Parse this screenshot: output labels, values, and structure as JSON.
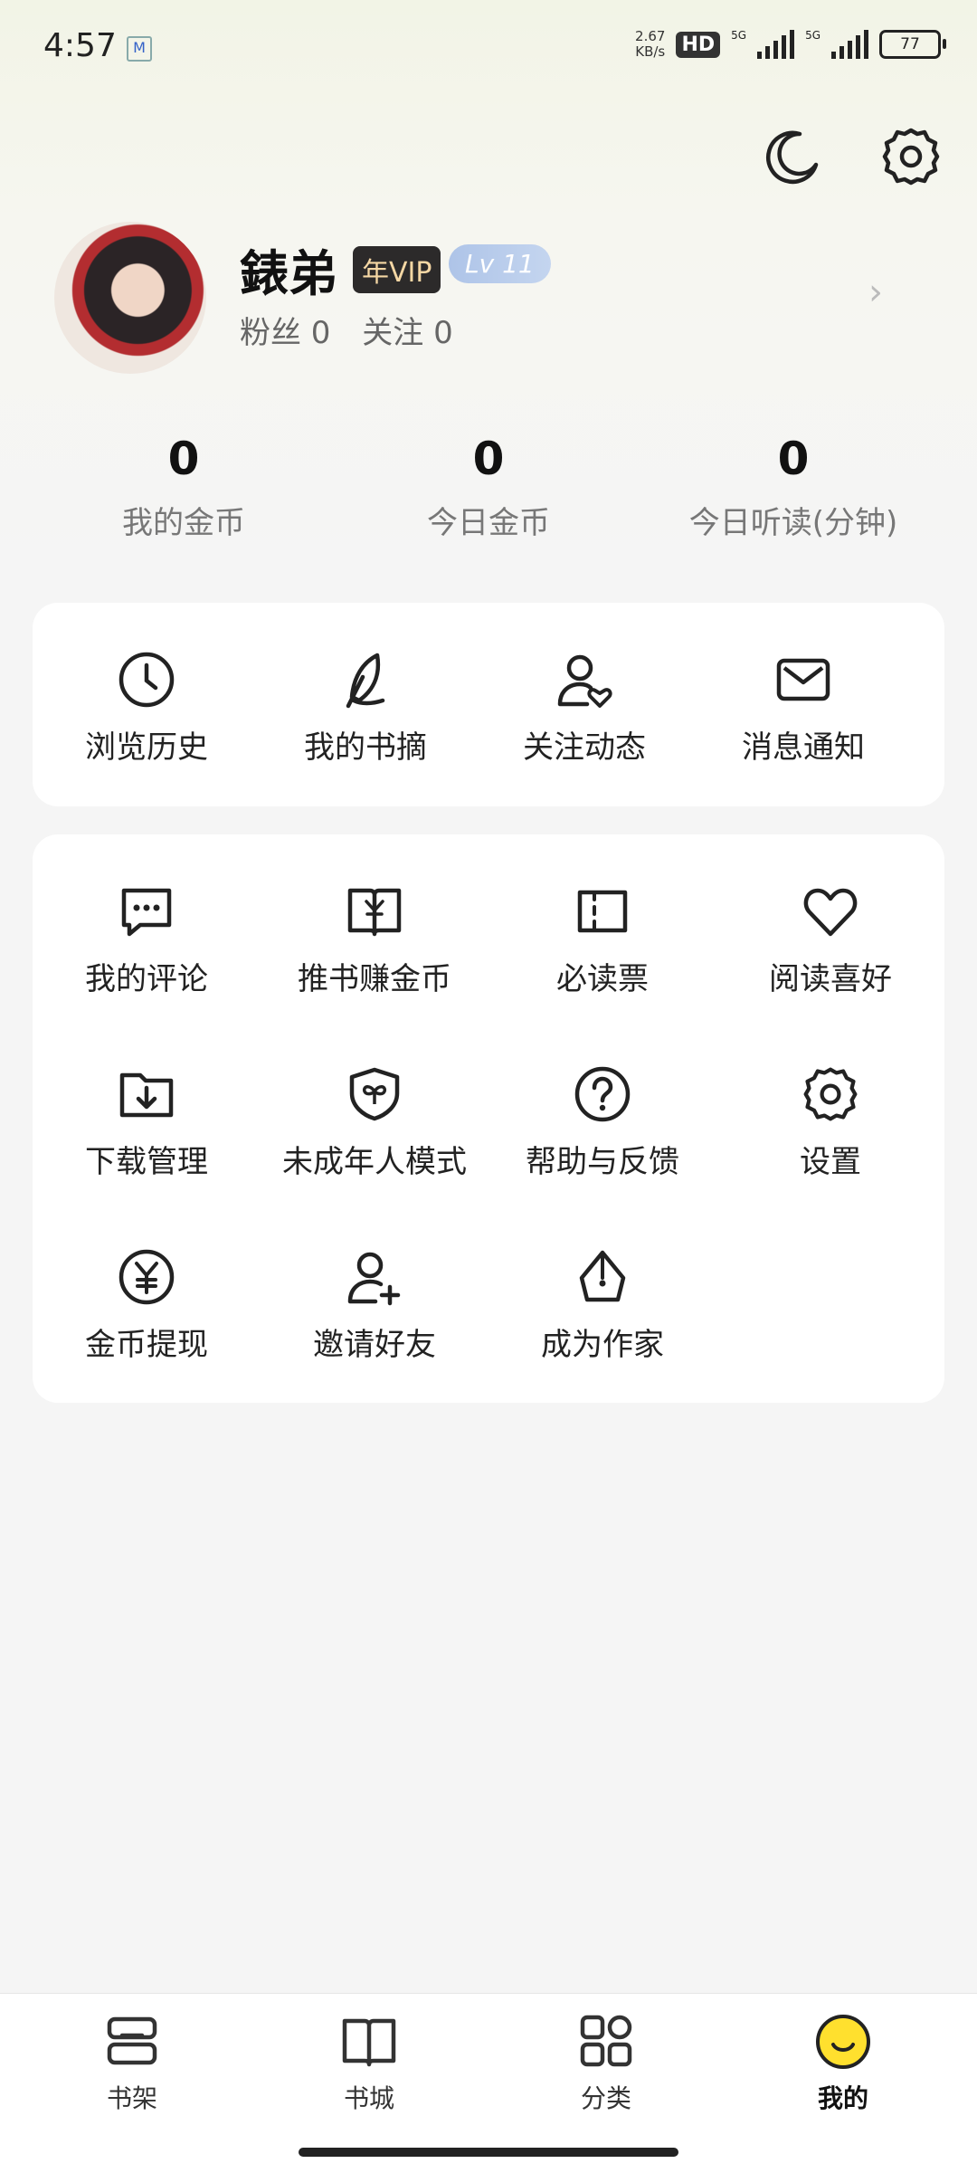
{
  "status_bar": {
    "time": "4:57",
    "network_speed": "2.67",
    "network_unit": "KB/s",
    "hd_label": "HD",
    "signal1_label": "5G",
    "signal2_label": "5G",
    "battery": "77"
  },
  "profile": {
    "name": "錶弟",
    "vip_badge": "年VIP",
    "level_badge": "Lv 11",
    "fans_label": "粉丝 0",
    "follow_label": "关注 0"
  },
  "stats": [
    {
      "value": "0",
      "label": "我的金币"
    },
    {
      "value": "0",
      "label": "今日金币"
    },
    {
      "value": "0",
      "label": "今日听读(分钟)"
    }
  ],
  "quick_actions": [
    {
      "label": "浏览历史",
      "icon": "clock-icon"
    },
    {
      "label": "我的书摘",
      "icon": "feather-icon"
    },
    {
      "label": "关注动态",
      "icon": "user-heart-icon"
    },
    {
      "label": "消息通知",
      "icon": "mail-icon"
    }
  ],
  "menu_items": [
    {
      "label": "我的评论",
      "icon": "comment-icon"
    },
    {
      "label": "推书赚金币",
      "icon": "book-coin-icon"
    },
    {
      "label": "必读票",
      "icon": "ticket-icon"
    },
    {
      "label": "阅读喜好",
      "icon": "heart-icon"
    },
    {
      "label": "下载管理",
      "icon": "download-folder-icon"
    },
    {
      "label": "未成年人模式",
      "icon": "shield-sprout-icon"
    },
    {
      "label": "帮助与反馈",
      "icon": "help-icon"
    },
    {
      "label": "设置",
      "icon": "gear-icon"
    },
    {
      "label": "金币提现",
      "icon": "coin-icon"
    },
    {
      "label": "邀请好友",
      "icon": "add-user-icon"
    },
    {
      "label": "成为作家",
      "icon": "pen-nib-icon"
    }
  ],
  "bottom_nav": [
    {
      "label": "书架",
      "icon": "bookshelf-icon"
    },
    {
      "label": "书城",
      "icon": "open-book-icon"
    },
    {
      "label": "分类",
      "icon": "grid-icon"
    },
    {
      "label": "我的",
      "icon": "smiley-icon"
    }
  ],
  "colors": {
    "accent_yellow": "#ffe02e",
    "vip_gold": "#f5d7a4",
    "level_blue": "#aec4e8"
  }
}
